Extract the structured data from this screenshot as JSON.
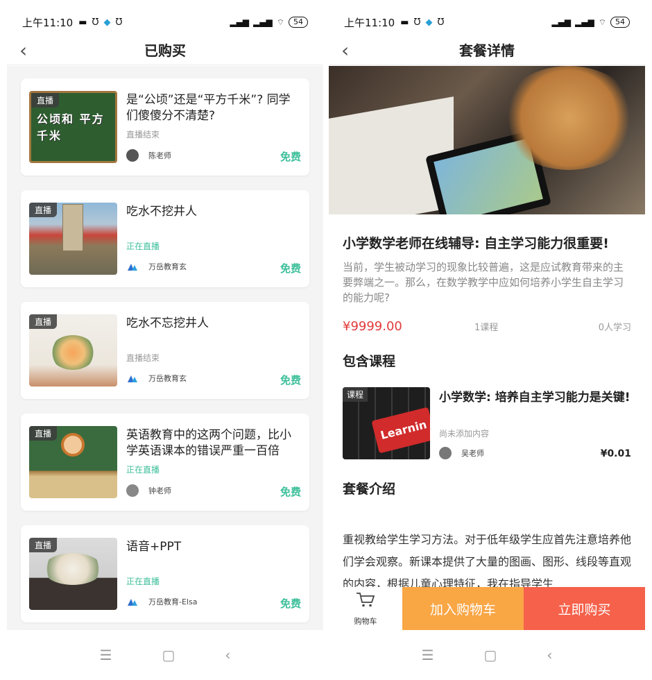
{
  "left": {
    "status": {
      "time": "上午11:10",
      "battery": "54"
    },
    "nav": {
      "title": "已购买"
    },
    "cards": [
      {
        "badge": "直播",
        "overlay": "公顷和 平方千米",
        "title": "是“公顷”还是“平方千米”? 同学们傻傻分不清楚?",
        "status": "直播结束",
        "teacher": "陈老师",
        "price": "免费"
      },
      {
        "badge": "直播",
        "overlay": "",
        "title": "吃水不挖井人",
        "status": "正在直播",
        "teacher": "万岳教育玄",
        "price": "免费"
      },
      {
        "badge": "直播",
        "overlay": "",
        "title": "吃水不忘挖井人",
        "status": "直播结束",
        "teacher": "万岳教育玄",
        "price": "免费"
      },
      {
        "badge": "直播",
        "overlay": "",
        "title": "英语教育中的这两个问题，比小学英语课本的错误严重一百倍",
        "status": "正在直播",
        "teacher": "钟老师",
        "price": "免费"
      },
      {
        "badge": "直播",
        "overlay": "",
        "title": "语音+PPT",
        "status": "正在直播",
        "teacher": "万岳教育-Elsa",
        "price": "免费"
      }
    ]
  },
  "right": {
    "status": {
      "time": "上午11:10",
      "battery": "54"
    },
    "nav": {
      "title": "套餐详情"
    },
    "detail": {
      "title": "小学数学老师在线辅导: 自主学习能力很重要!",
      "desc": "当前，学生被动学习的现象比较普遍，这是应试教育带来的主要弊端之一。那么，在数学教学中应如何培养小学生自主学习的能力呢?",
      "price": "¥9999.00",
      "course_count": "1课程",
      "learners": "0人学习"
    },
    "included_heading": "包含课程",
    "course": {
      "badge": "课程",
      "thumb_text": "Learnin",
      "title": "小学数学: 培养自主学习能力是关键!",
      "sub": "尚未添加内容",
      "teacher": "吴老师",
      "price": "¥0.01"
    },
    "intro_heading": "套餐介绍",
    "intro_text": "重视教给学生学习方法。对于低年级学生应首先注意培养他们学会观察。新课本提供了大量的图画、图形、线段等直观的内容，根据儿童心理特征，我在指导学生",
    "bottom": {
      "cart": "购物车",
      "add": "加入购物车",
      "buy": "立即购买"
    }
  },
  "colors": {
    "accent_green": "#3dbf9b",
    "price_red": "#e23b3b",
    "orange": "#f9a645",
    "red_orange": "#f5614a"
  }
}
